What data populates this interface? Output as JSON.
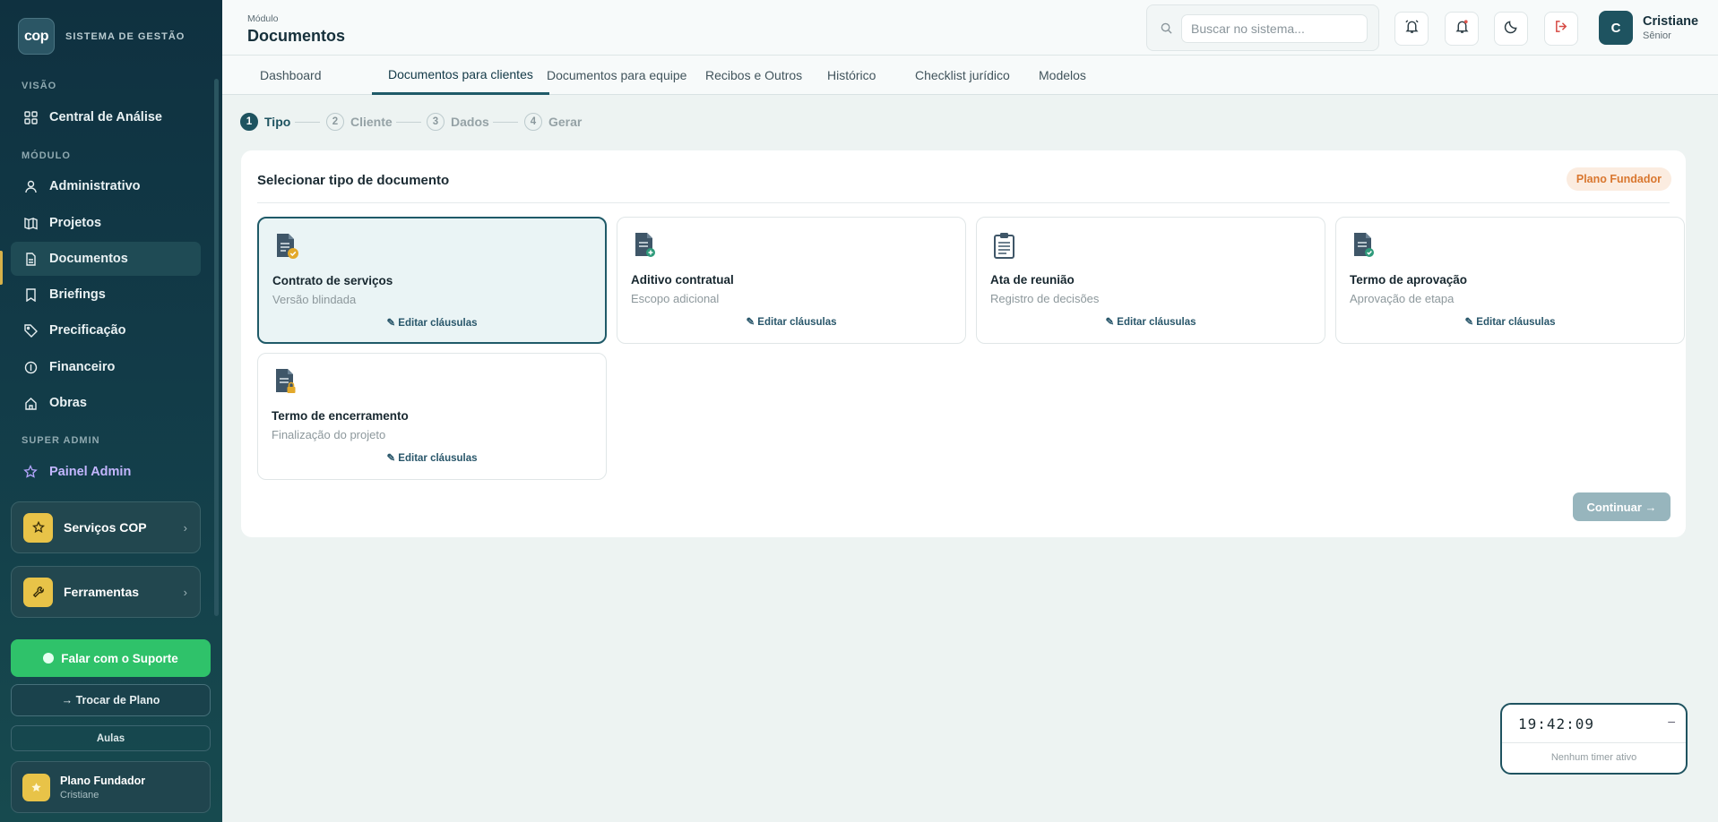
{
  "brand": {
    "logo_text": "cop",
    "name": "SISTEMA DE GESTÃO"
  },
  "sidebar": {
    "sections": {
      "visao": "VISÃO",
      "modulo": "MÓDULO",
      "super_admin": "SUPER ADMIN"
    },
    "items": [
      {
        "label": "Central de Análise",
        "icon": "grid-icon"
      },
      {
        "label": "Administrativo",
        "icon": "user-icon"
      },
      {
        "label": "Projetos",
        "icon": "map-icon"
      },
      {
        "label": "Documentos",
        "icon": "document-icon",
        "active": true
      },
      {
        "label": "Briefings",
        "icon": "bookmark-icon"
      },
      {
        "label": "Precificação",
        "icon": "tag-icon"
      },
      {
        "label": "Financeiro",
        "icon": "coin-icon"
      },
      {
        "label": "Obras",
        "icon": "home-icon"
      },
      {
        "label": "Painel Admin",
        "icon": "star-icon"
      }
    ],
    "promos": [
      {
        "label": "Serviços COP",
        "icon": "star-icon"
      },
      {
        "label": "Ferramentas",
        "icon": "wrench-icon"
      }
    ],
    "support_label": "Falar com o Suporte",
    "plan_switch_label": "→  Trocar de Plano",
    "aulas_label": "Aulas",
    "plan_card": {
      "title": "Plano Fundador",
      "user": "Cristiane"
    }
  },
  "header": {
    "crumb": "Módulo",
    "title": "Documentos",
    "search_placeholder": "Buscar no sistema...",
    "user": {
      "initial": "C",
      "name": "Cristiane",
      "role": "Sênior"
    }
  },
  "tabs": [
    {
      "label": "Dashboard"
    },
    {
      "label": "Documentos para clientes",
      "active": true
    },
    {
      "label": "Documentos para equipe"
    },
    {
      "label": "Recibos e Outros"
    },
    {
      "label": "Histórico"
    },
    {
      "label": "Checklist jurídico"
    },
    {
      "label": "Modelos"
    }
  ],
  "stepper": [
    {
      "num": "1",
      "label": "Tipo",
      "active": true
    },
    {
      "num": "2",
      "label": "Cliente"
    },
    {
      "num": "3",
      "label": "Dados"
    },
    {
      "num": "4",
      "label": "Gerar"
    }
  ],
  "main": {
    "title": "Selecionar tipo de documento",
    "badge": "Plano Fundador",
    "documents": [
      {
        "title": "Contrato de serviços",
        "subtitle": "Versão blindada",
        "edit": "✎ Editar cláusulas",
        "icon": "document-shield-icon",
        "selected": true
      },
      {
        "title": "Aditivo contratual",
        "subtitle": "Escopo adicional",
        "edit": "✎ Editar cláusulas",
        "icon": "document-plus-icon"
      },
      {
        "title": "Ata de reunião",
        "subtitle": "Registro de decisões",
        "edit": "✎ Editar cláusulas",
        "icon": "clipboard-icon"
      },
      {
        "title": "Termo de aprovação",
        "subtitle": "Aprovação de etapa",
        "edit": "✎ Editar cláusulas",
        "icon": "document-check-icon"
      },
      {
        "title": "Termo de encerramento",
        "subtitle": "Finalização do projeto",
        "edit": "✎ Editar cláusulas",
        "icon": "document-lock-icon"
      }
    ],
    "continue_label": "Continuar →"
  },
  "timer": {
    "time": "19:42:09",
    "status": "Nenhum timer ativo",
    "minimize": "–"
  },
  "colors": {
    "accent": "#1e5360",
    "sidebar": "#123b48",
    "gold": "#e8c348",
    "support": "#2fc26a",
    "badge_text": "#d9772f"
  }
}
